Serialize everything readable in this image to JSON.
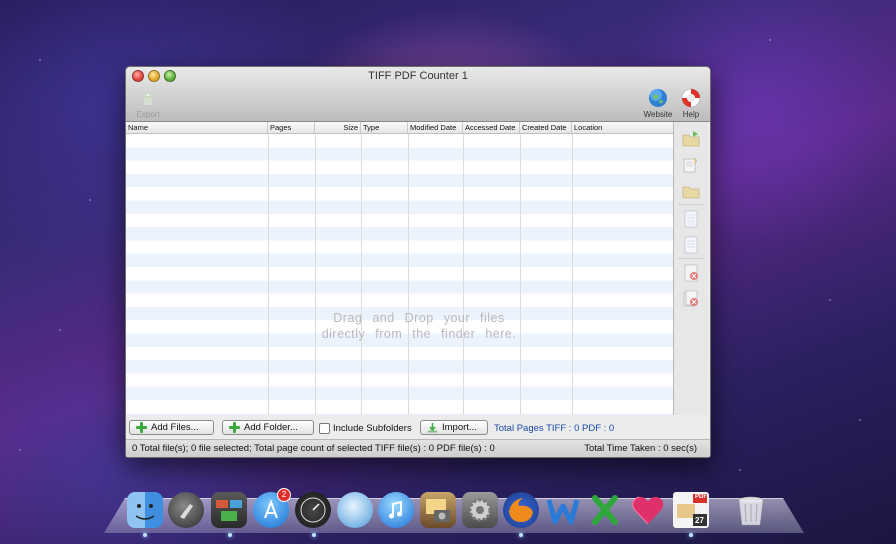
{
  "window": {
    "title": "TIFF PDF Counter 1",
    "toolbar": {
      "export_label": "Export",
      "website_label": "Website",
      "help_label": "Help"
    }
  },
  "table": {
    "columns": [
      "Name",
      "Pages",
      "Size",
      "Type",
      "Modified Date",
      "Accessed Date",
      "Created Date",
      "Location"
    ],
    "drop_message_line1": "Drag and Drop your files",
    "drop_message_line2": "directly from the finder here."
  },
  "sidebar": {
    "icons": [
      "add-folder-icon",
      "add-document-icon",
      "open-folder-icon",
      "page-icon",
      "page-icon",
      "remove-file-icon",
      "remove-all-icon"
    ]
  },
  "controls": {
    "add_files_label": "Add Files...",
    "add_folder_label": "Add Folder...",
    "include_subfolders_label": "Include Subfolders",
    "include_subfolders_checked": false,
    "import_label": "Import...",
    "total_pages": "Total Pages TIFF : 0 PDF : 0"
  },
  "status": {
    "left": "0 Total file(s); 0 file selected; Total page count of selected TIFF file(s) : 0 PDF file(s) : 0",
    "right": "Total Time Taken : 0 sec(s)"
  },
  "dock": {
    "app_store_badge": "2",
    "calendar_day": "27",
    "pdf_label": "PDF"
  }
}
